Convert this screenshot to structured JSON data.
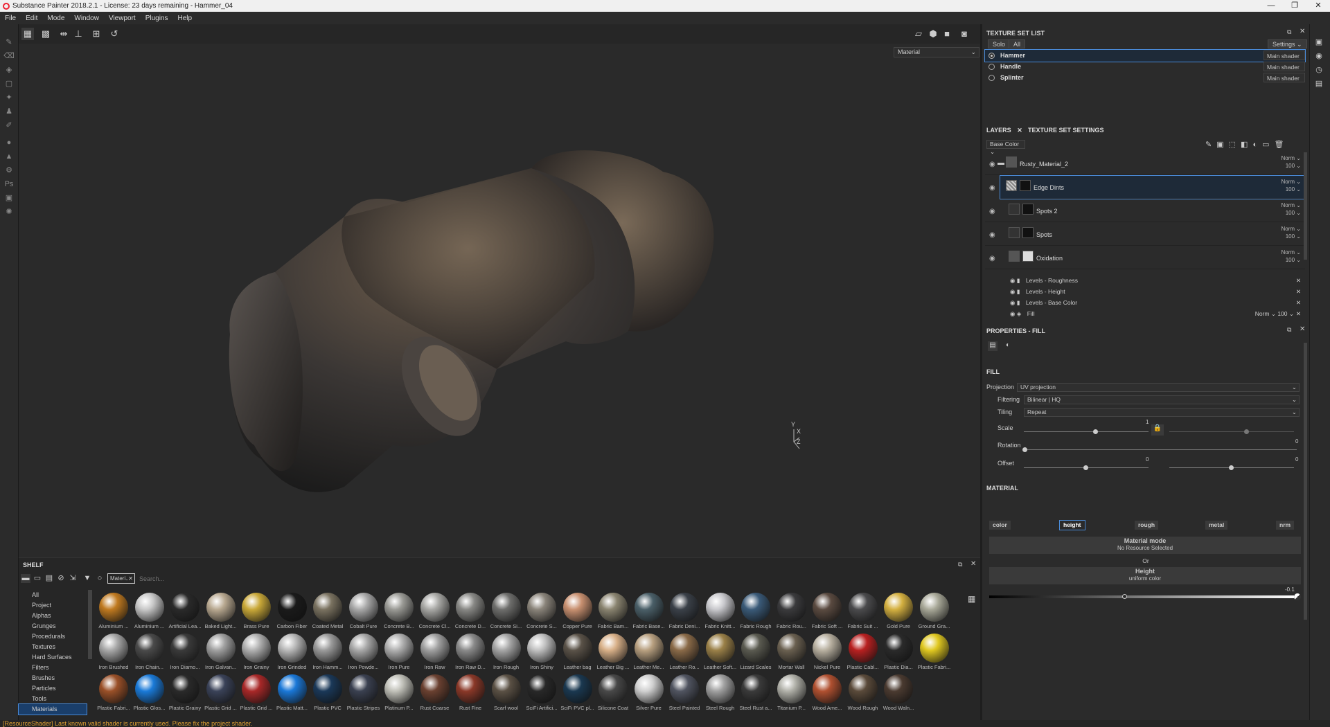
{
  "window": {
    "title": "Substance Painter 2018.2.1 - License: 23 days remaining - Hammer_04",
    "btns": [
      "—",
      "❐",
      "✕"
    ]
  },
  "menu": [
    "File",
    "Edit",
    "Mode",
    "Window",
    "Viewport",
    "Plugins",
    "Help"
  ],
  "viewport": {
    "material_select": "Material",
    "axis": {
      "y": "Y",
      "x": "X",
      "z": "Z"
    }
  },
  "status": "[ResourceShader] Last known valid shader is currently used. Please fix the project shader.",
  "shelf": {
    "title": "SHELF",
    "filter_tag": "Materi...",
    "search_placeholder": "Search...",
    "categories": [
      "All",
      "Project",
      "Alphas",
      "Grunges",
      "Procedurals",
      "Textures",
      "Hard Surfaces",
      "Filters",
      "Brushes",
      "Particles",
      "Tools",
      "Materials"
    ],
    "materials": [
      [
        "Aluminium ...",
        "#c07a20"
      ],
      [
        "Aluminium ...",
        "#c8c8c8"
      ],
      [
        "Artificial Lea...",
        "#2a2a2a"
      ],
      [
        "Baked Light...",
        "#b8a890"
      ],
      [
        "Brass Pure",
        "#c9a838"
      ],
      [
        "Carbon Fiber",
        "#1a1a1a"
      ],
      [
        "Coated Metal",
        "#7a7260"
      ],
      [
        "Cobalt Pure",
        "#a8a8a8"
      ],
      [
        "Concrete B...",
        "#9a9a95"
      ],
      [
        "Concrete Cl...",
        "#a8a8a5"
      ],
      [
        "Concrete D...",
        "#888885"
      ],
      [
        "Concrete Si...",
        "#6e6e6c"
      ],
      [
        "Concrete S...",
        "#8a847a"
      ],
      [
        "Copper Pure",
        "#c89070"
      ],
      [
        "Fabric Bam...",
        "#8a8470"
      ],
      [
        "Fabric Base...",
        "#4a5f68"
      ],
      [
        "Fabric Deni...",
        "#3a4048"
      ],
      [
        "Fabric Knitt...",
        "#c8c8cc"
      ],
      [
        "Fabric Rough",
        "#3a5a78"
      ],
      [
        "Fabric Rou...",
        "#3a3a3c"
      ],
      [
        "Fabric Soft ...",
        "#5a4a40"
      ],
      [
        "Fabric Suit ...",
        "#4a4a4c"
      ],
      [
        "Gold Pure",
        "#d4b040"
      ],
      [
        "Ground Gra...",
        "#a8a898"
      ],
      [
        "Iron Brushed",
        "#a8a8a8"
      ],
      [
        "Iron Chain...",
        "#4a4a4a"
      ],
      [
        "Iron Diamo...",
        "#3a3a3a"
      ],
      [
        "Iron Galvan...",
        "#a0a0a0"
      ],
      [
        "Iron Grainy",
        "#b0b0b0"
      ],
      [
        "Iron Grinded",
        "#b8b8b8"
      ],
      [
        "Iron Hamm...",
        "#9a9a9a"
      ],
      [
        "Iron Powde...",
        "#a8a8a8"
      ],
      [
        "Iron Pure",
        "#b0b0b0"
      ],
      [
        "Iron Raw",
        "#a0a0a0"
      ],
      [
        "Iron Raw D...",
        "#8a8a8a"
      ],
      [
        "Iron Rough",
        "#a5a5a5"
      ],
      [
        "Iron Shiny",
        "#c0c0c0"
      ],
      [
        "Leather bag",
        "#5a5248"
      ],
      [
        "Leather Big ...",
        "#d8b088"
      ],
      [
        "Leather Me...",
        "#b8a080"
      ],
      [
        "Leather Ro...",
        "#8a6a48"
      ],
      [
        "Leather Soft...",
        "#9a8048"
      ],
      [
        "Lizard Scales",
        "#5a5a50"
      ],
      [
        "Mortar Wall",
        "#6a6050"
      ],
      [
        "Nickel Pure",
        "#b8b0a0"
      ],
      [
        "Plastic Cabl...",
        "#b82020"
      ],
      [
        "Plastic Dia...",
        "#2a2a2a"
      ],
      [
        "Plastic Fabri...",
        "#e0c820"
      ],
      [
        "Plastic Fabri...",
        "#9a5028"
      ],
      [
        "Plastic Glos...",
        "#1a7ad8"
      ],
      [
        "Plastic Grainy",
        "#2a2a2a"
      ],
      [
        "Plastic Grid ...",
        "#3a4258"
      ],
      [
        "Plastic Grid ...",
        "#a82828"
      ],
      [
        "Plastic Matt...",
        "#1a78d8"
      ],
      [
        "Plastic PVC",
        "#1a3858"
      ],
      [
        "Plastic Stripes",
        "#3a4050"
      ],
      [
        "Platinum P...",
        "#c0c0b8"
      ],
      [
        "Rust Coarse",
        "#6a4030"
      ],
      [
        "Rust Fine",
        "#8a3828"
      ],
      [
        "Scarf wool",
        "#5a5044"
      ],
      [
        "SciFi Artifici...",
        "#282828"
      ],
      [
        "SciFi PVC pl...",
        "#1a3850"
      ],
      [
        "Silicone Coat",
        "#484848"
      ],
      [
        "Silver Pure",
        "#d0d0d0"
      ],
      [
        "Steel Painted",
        "#505460"
      ],
      [
        "Steel Rough",
        "#a0a0a0"
      ],
      [
        "Steel Rust a...",
        "#3a3a3a"
      ],
      [
        "Titanium P...",
        "#b0b0a8"
      ],
      [
        "Wood Ame...",
        "#b05030"
      ],
      [
        "Wood Rough",
        "#5a4a3a"
      ],
      [
        "Wood Waln...",
        "#4a3a30"
      ]
    ]
  },
  "texture_set_list": {
    "title": "TEXTURE SET LIST",
    "solo": "Solo",
    "all": "All",
    "settings": "Settings",
    "sets": [
      {
        "name": "Hammer",
        "shader": "Main shader"
      },
      {
        "name": "Handle",
        "shader": "Main shader"
      },
      {
        "name": "Splinter",
        "shader": "Main shader"
      }
    ]
  },
  "layers": {
    "tab1": "LAYERS",
    "tab2": "TEXTURE SET SETTINGS",
    "channel": "Base Color",
    "items": [
      {
        "name": "Rusty_Material_2",
        "blend": "Norm",
        "opacity": "100"
      },
      {
        "name": "Edge Dints",
        "blend": "Norm",
        "opacity": "100"
      },
      {
        "name": "Spots 2",
        "blend": "Norm",
        "opacity": "100"
      },
      {
        "name": "Spots",
        "blend": "Norm",
        "opacity": "100"
      },
      {
        "name": "Oxidation",
        "blend": "Norm",
        "opacity": "100"
      }
    ],
    "effects": [
      "Levels - Roughness",
      "Levels - Height",
      "Levels - Base Color",
      "Fill"
    ],
    "fill_blend": "Norm",
    "fill_opacity": "100"
  },
  "properties": {
    "title": "PROPERTIES - FILL",
    "section": "FILL",
    "projection_label": "Projection",
    "projection": "UV projection",
    "filtering_label": "Filtering",
    "filtering": "Bilinear | HQ",
    "tiling_label": "Tiling",
    "tiling": "Repeat",
    "scale_label": "Scale",
    "scale_value": "1",
    "rotation_label": "Rotation",
    "rotation_value": "0",
    "offset_label": "Offset",
    "offset_x": "0",
    "offset_y": "0",
    "material_section": "MATERIAL",
    "channels": [
      "color",
      "height",
      "rough",
      "metal",
      "nrm"
    ],
    "material_mode": "Material mode",
    "no_resource": "No Resource Selected",
    "or": "Or",
    "height": "Height",
    "uniform": "uniform color",
    "height_value": "-0.1"
  }
}
